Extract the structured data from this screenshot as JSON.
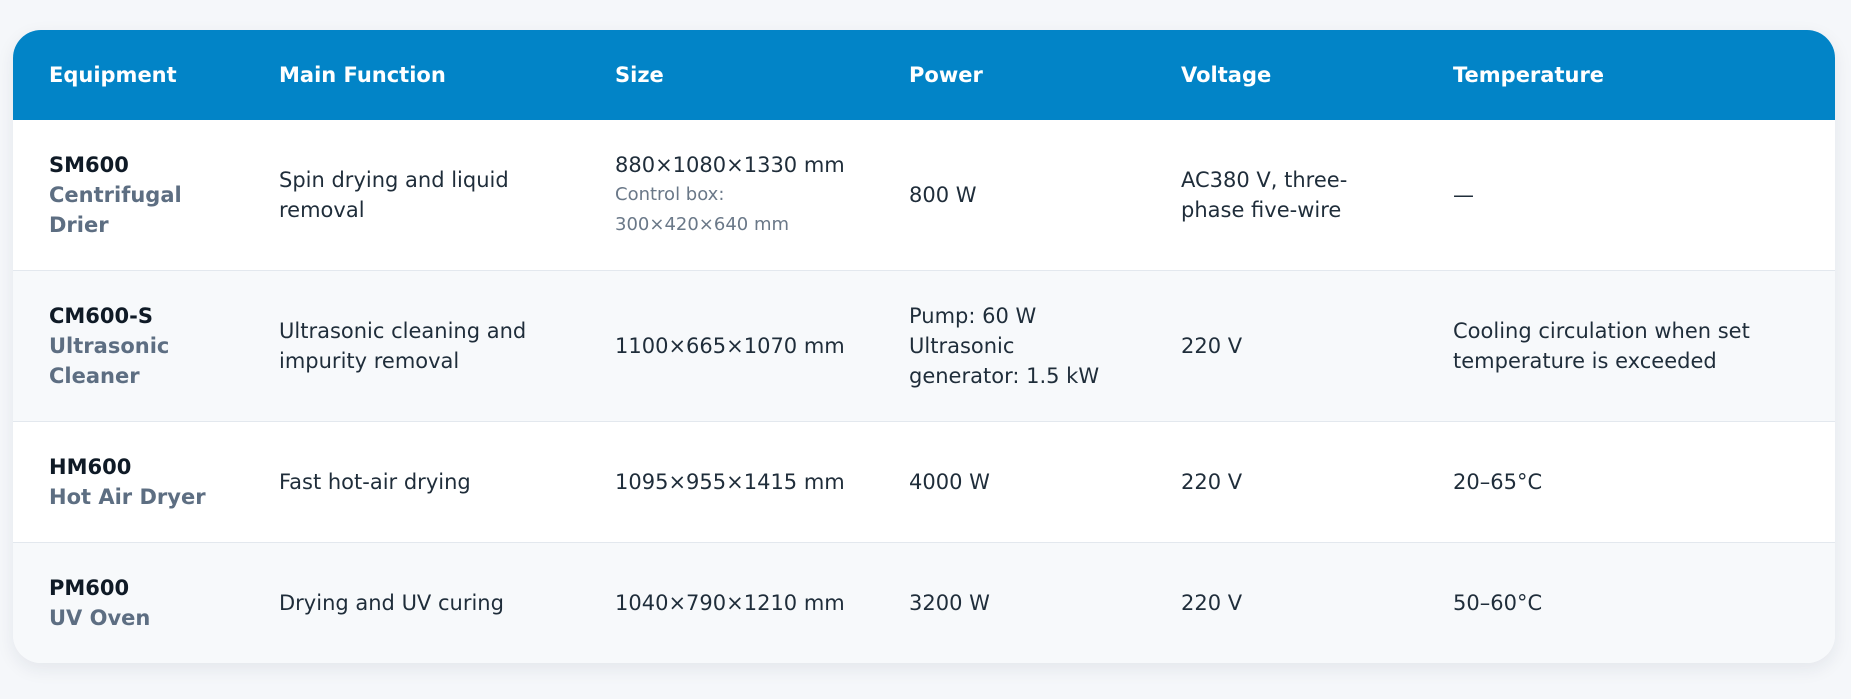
{
  "header": {
    "equipment": "Equipment",
    "main_function": "Main Function",
    "size": "Size",
    "power": "Power",
    "voltage": "Voltage",
    "temperature": "Temperature"
  },
  "rows": [
    {
      "code": "SM600",
      "name": "Centrifugal Drier",
      "function": "Spin drying and liquid removal",
      "size": "880×1080×1330 mm",
      "size_note": "Control box: 300×420×640 mm",
      "power": "800 W",
      "voltage": "AC380 V, three-phase five-wire",
      "temperature": "—"
    },
    {
      "code": "CM600-S",
      "name": "Ultrasonic Cleaner",
      "function": "Ultrasonic cleaning and impurity removal",
      "size": "1100×665×1070 mm",
      "power_lines": [
        "Pump: 60 W",
        "Ultrasonic generator: 1.5 kW"
      ],
      "voltage": "220 V",
      "temperature": "Cooling circulation when set temperature is exceeded"
    },
    {
      "code": "HM600",
      "name": "Hot Air Dryer",
      "function": "Fast hot-air drying",
      "size": "1095×955×1415 mm",
      "power": "4000 W",
      "voltage": "220 V",
      "temperature": "20–65°C"
    },
    {
      "code": "PM600",
      "name": "UV Oven",
      "function": "Drying and UV curing",
      "size": "1040×790×1210 mm",
      "power": "3200 W",
      "voltage": "220 V",
      "temperature": "50–60°C"
    }
  ],
  "colors": {
    "header_bg": "#0284c7",
    "header_text": "#ffffff",
    "row_alt_bg": "#f7f9fb",
    "equipment_name": "#5d6e82"
  }
}
